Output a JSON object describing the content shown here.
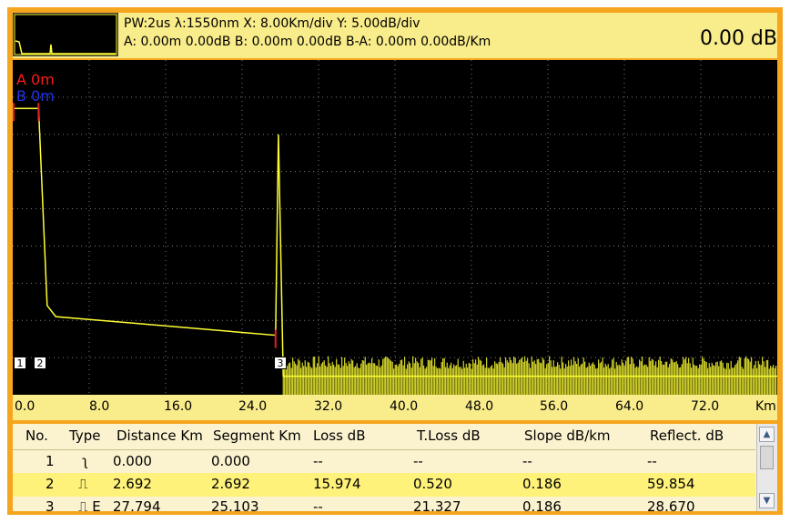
{
  "header": {
    "line1": "PW:2us λ:1550nm  X: 8.00Km/div Y: 5.00dB/div",
    "line2": "A: 0.00m 0.00dB B: 0.00m 0.00dB B-A: 0.00m 0.00dB/Km",
    "value": "0.00 dB"
  },
  "cursors": {
    "a": "A 0m",
    "b": "B 0m"
  },
  "events": [
    "1",
    "2",
    "3"
  ],
  "x_axis": {
    "ticks": [
      "0.0",
      "8.0",
      "16.0",
      "24.0",
      "32.0",
      "40.0",
      "48.0",
      "56.0",
      "64.0",
      "72.0"
    ],
    "unit": "Km"
  },
  "table": {
    "headers": [
      "No.",
      "Type",
      "Distance Km",
      "Segment Km",
      "Loss dB",
      "T.Loss dB",
      "Slope dB/km",
      "Reflect. dB"
    ],
    "rows": [
      {
        "no": "1",
        "type": "ʅ",
        "distance": "0.000",
        "segment": "0.000",
        "loss": "--",
        "tloss": "--",
        "slope": "--",
        "reflect": "--"
      },
      {
        "no": "2",
        "type": "⎍",
        "distance": "2.692",
        "segment": "2.692",
        "loss": "15.974",
        "tloss": "0.520",
        "slope": "0.186",
        "reflect": "59.854"
      },
      {
        "no": "3",
        "type": "⎍ E",
        "distance": "27.794",
        "segment": "25.103",
        "loss": "--",
        "tloss": "21.327",
        "slope": "0.186",
        "reflect": "28.670"
      }
    ]
  },
  "chart_data": {
    "type": "line",
    "xlabel": "Km",
    "xlim": [
      0,
      80
    ],
    "trace": [
      [
        0,
        -1.5
      ],
      [
        2.7,
        -1.5
      ],
      [
        3.6,
        -28
      ],
      [
        4.5,
        -29.5
      ],
      [
        27.5,
        -32
      ],
      [
        27.8,
        -5
      ],
      [
        28.3,
        -37.5
      ],
      [
        80,
        -37.5
      ]
    ],
    "colors": {
      "trace": "#ffff33",
      "grid": "#7a7a7a"
    }
  }
}
